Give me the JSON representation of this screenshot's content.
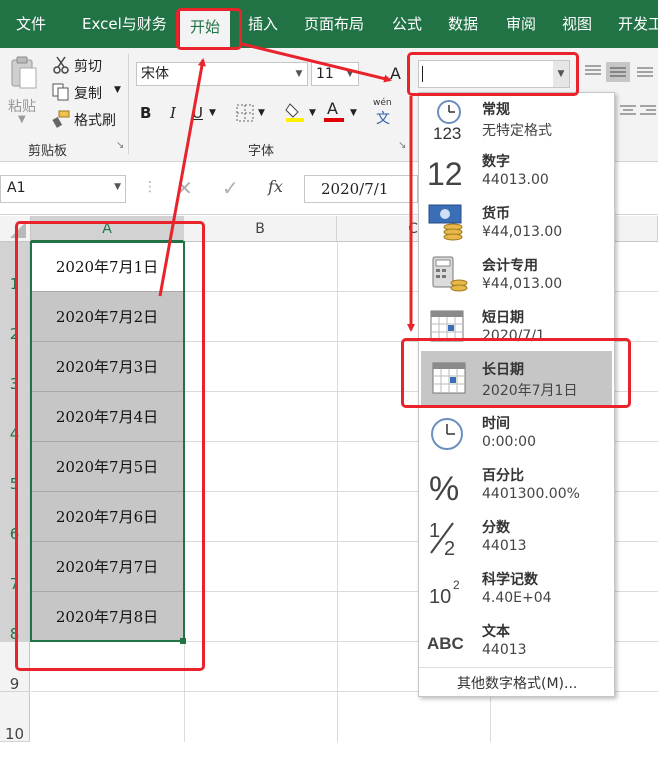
{
  "tabs": [
    {
      "label": "文件"
    },
    {
      "label": "Excel与财务"
    },
    {
      "label": "开始"
    },
    {
      "label": "插入"
    },
    {
      "label": "页面布局"
    },
    {
      "label": "公式"
    },
    {
      "label": "数据"
    },
    {
      "label": "审阅"
    },
    {
      "label": "视图"
    },
    {
      "label": "开发工"
    }
  ],
  "ribbon": {
    "paste": "粘贴",
    "cut": "剪切",
    "copy": "复制",
    "format_painter": "格式刷",
    "clipboard_group": "剪贴板",
    "font_name": "宋体",
    "font_size": "11",
    "font_group": "字体",
    "bold": "B",
    "italic": "I",
    "underline": "U",
    "font_color_letter": "A",
    "grow_font": "A",
    "wen": "wén",
    "wen_char": "文",
    "number_format_value": ""
  },
  "formula_bar": {
    "name_box": "A1",
    "fx": "fx",
    "content": "2020/7/1"
  },
  "grid": {
    "columns": [
      "A",
      "B",
      "C"
    ],
    "rows": [
      "1",
      "2",
      "3",
      "4",
      "5",
      "6",
      "7",
      "8",
      "9",
      "10"
    ],
    "cells": [
      "2020年7月1日",
      "2020年7月2日",
      "2020年7月3日",
      "2020年7月4日",
      "2020年7月5日",
      "2020年7月6日",
      "2020年7月7日",
      "2020年7月8日"
    ]
  },
  "number_formats": [
    {
      "name": "常规",
      "example": "无特定格式",
      "icon": "clock-123-icon"
    },
    {
      "name": "数字",
      "example": "44013.00",
      "icon": "number-12-icon"
    },
    {
      "name": "货币",
      "example": "¥44,013.00",
      "icon": "currency-icon"
    },
    {
      "name": "会计专用",
      "example": " ¥44,013.00",
      "icon": "accounting-icon"
    },
    {
      "name": "短日期",
      "example": "2020/7/1",
      "icon": "calendar-icon"
    },
    {
      "name": "长日期",
      "example": "2020年7月1日",
      "icon": "calendar-icon"
    },
    {
      "name": "时间",
      "example": "0:00:00",
      "icon": "clock-icon"
    },
    {
      "name": "百分比",
      "example": "4401300.00%",
      "icon": "percent-icon"
    },
    {
      "name": "分数",
      "example": "44013",
      "icon": "fraction-icon"
    },
    {
      "name": "科学记数",
      "example": "4.40E+04",
      "icon": "scientific-icon"
    },
    {
      "name": "文本",
      "example": "44013",
      "icon": "abc-icon"
    }
  ],
  "more_formats": "其他数字格式(M)...",
  "icon_text": {
    "n123": "123",
    "n12": "12",
    "pct": "%",
    "frac_num": "1",
    "frac_den": "2",
    "sci_base": "10",
    "sci_exp": "2",
    "abc": "ABC"
  },
  "colors": {
    "accent": "#217346",
    "annotation": "#e8232b",
    "selection": "#c6c6c6"
  }
}
